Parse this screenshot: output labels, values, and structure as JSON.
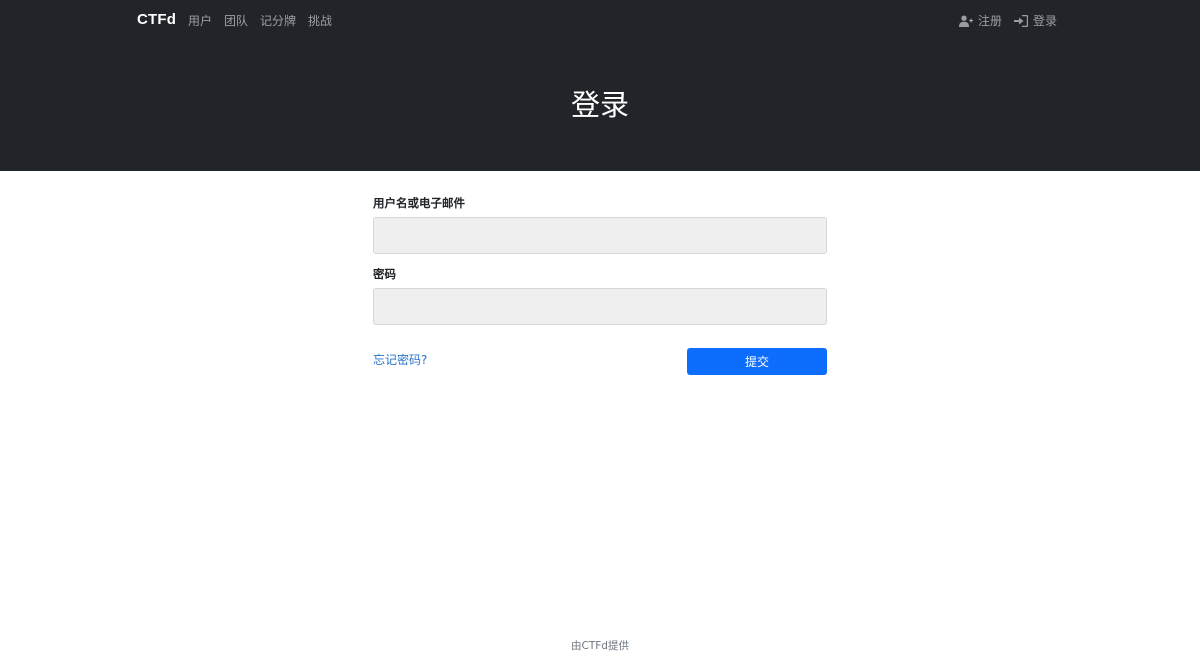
{
  "navbar": {
    "brand": "CTFd",
    "links": [
      "用户",
      "团队",
      "记分牌",
      "挑战"
    ],
    "right": [
      {
        "label": "注册",
        "icon": "user-plus-icon"
      },
      {
        "label": "登录",
        "icon": "sign-in-icon"
      }
    ]
  },
  "page": {
    "title": "登录"
  },
  "form": {
    "username_label": "用户名或电子邮件",
    "username_value": "",
    "password_label": "密码",
    "password_value": "",
    "forgot_link": "忘记密码?",
    "submit_label": "提交"
  },
  "footer": {
    "text": "由CTFd提供"
  },
  "colors": {
    "navbar_bg": "#212529",
    "primary": "#0d6efd",
    "link": "#2a74c8",
    "input_bg": "#efefef"
  }
}
